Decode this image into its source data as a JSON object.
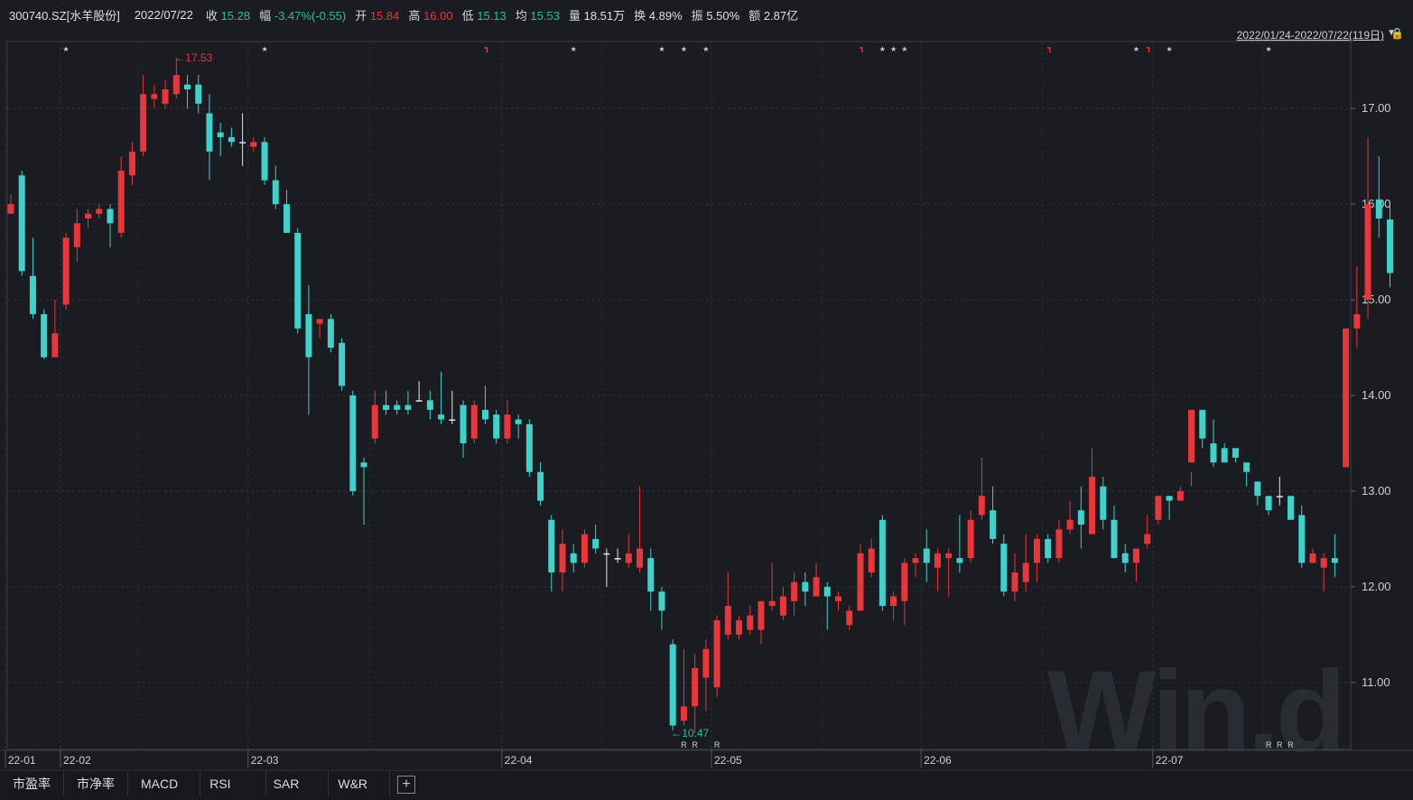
{
  "header": {
    "code": "300740.SZ[水羊股份]",
    "date": "2022/07/22",
    "close_label": "收",
    "close": "15.28",
    "change_label": "幅",
    "change": "-3.47%(-0.55)",
    "open_label": "开",
    "open": "15.84",
    "high_label": "高",
    "high": "16.00",
    "low_label": "低",
    "low": "15.13",
    "avg_label": "均",
    "avg": "15.53",
    "volume_label": "量",
    "volume": "18.51万",
    "turnover_label": "换",
    "turnover": "4.89%",
    "amplitude_label": "振",
    "amplitude": "5.50%",
    "amount_label": "额",
    "amount": "2.87亿"
  },
  "range_text": "2022/01/24-2022/07/22(119日)",
  "icons": {
    "dropdown": "triangle-down-icon",
    "lock": "lock-icon",
    "add": "plus-icon"
  },
  "colors": {
    "up": "#e8363a",
    "down": "#3fd1cc",
    "up_text": "#e8363a",
    "down_text": "#26c281",
    "grid": "#2e3138",
    "background": "#1a1c22"
  },
  "tabs": [
    "市盈率",
    "市净率",
    "MACD",
    "RSI",
    "SAR",
    "W&R"
  ],
  "watermark": "Win.d",
  "chart_data": {
    "type": "candlestick",
    "ylim": [
      10.3,
      17.7
    ],
    "yticks": [
      "17.00",
      "16.00",
      "15.00",
      "14.00",
      "13.00",
      "12.00",
      "11.00"
    ],
    "ytick_values": [
      17,
      16,
      15,
      14,
      13,
      12,
      11
    ],
    "xticks": [
      {
        "label": "22-01",
        "index": 0
      },
      {
        "label": "22-02",
        "index": 5
      },
      {
        "label": "22-03",
        "index": 22
      },
      {
        "label": "22-04",
        "index": 45
      },
      {
        "label": "22-05",
        "index": 64
      },
      {
        "label": "22-06",
        "index": 83
      },
      {
        "label": "22-07",
        "index": 104
      }
    ],
    "annotations": {
      "max": {
        "label": "17.53",
        "index": 15,
        "value": 17.53
      },
      "min": {
        "label": "10.47",
        "index": 60,
        "value": 10.47
      }
    },
    "markers": {
      "star": [
        5,
        23,
        51,
        59,
        61,
        63,
        79,
        80,
        81,
        102,
        105,
        114
      ],
      "flag": [
        43,
        77,
        94,
        103
      ],
      "R": [
        61,
        62,
        64,
        114,
        115,
        116
      ]
    },
    "candles": [
      [
        15.9,
        16.0,
        15.9,
        16.1
      ],
      [
        16.3,
        15.3,
        15.25,
        16.35
      ],
      [
        15.25,
        14.85,
        14.8,
        15.65
      ],
      [
        14.85,
        14.4,
        14.38,
        14.9
      ],
      [
        14.4,
        14.65,
        14.4,
        15.0
      ],
      [
        14.95,
        15.65,
        14.9,
        15.7
      ],
      [
        15.55,
        15.8,
        15.4,
        15.95
      ],
      [
        15.85,
        15.9,
        15.75,
        15.95
      ],
      [
        15.9,
        15.95,
        15.85,
        16.0
      ],
      [
        15.95,
        15.8,
        15.55,
        16.0
      ],
      [
        15.7,
        16.35,
        15.65,
        16.5
      ],
      [
        16.3,
        16.55,
        16.2,
        16.65
      ],
      [
        16.55,
        17.15,
        16.5,
        17.35
      ],
      [
        17.1,
        17.15,
        17.0,
        17.25
      ],
      [
        17.05,
        17.2,
        17.0,
        17.3
      ],
      [
        17.15,
        17.35,
        17.1,
        17.53
      ],
      [
        17.25,
        17.2,
        17.0,
        17.35
      ],
      [
        17.25,
        17.05,
        16.95,
        17.35
      ],
      [
        16.95,
        16.55,
        16.25,
        17.15
      ],
      [
        16.75,
        16.7,
        16.5,
        16.85
      ],
      [
        16.7,
        16.65,
        16.6,
        16.8
      ],
      [
        16.65,
        16.65,
        16.4,
        16.95
      ],
      [
        16.6,
        16.65,
        16.55,
        16.7
      ],
      [
        16.65,
        16.25,
        16.2,
        16.7
      ],
      [
        16.25,
        16.0,
        15.95,
        16.4
      ],
      [
        16.0,
        15.7,
        15.7,
        16.15
      ],
      [
        15.7,
        14.7,
        14.65,
        15.75
      ],
      [
        14.85,
        14.4,
        13.8,
        15.15
      ],
      [
        14.75,
        14.8,
        14.6,
        14.8
      ],
      [
        14.8,
        14.5,
        14.45,
        14.85
      ],
      [
        14.55,
        14.1,
        14.05,
        14.6
      ],
      [
        14.0,
        13.0,
        12.95,
        14.05
      ],
      [
        13.3,
        13.25,
        12.65,
        13.35
      ],
      [
        13.55,
        13.9,
        13.5,
        14.05
      ],
      [
        13.9,
        13.85,
        13.8,
        14.05
      ],
      [
        13.9,
        13.85,
        13.8,
        13.95
      ],
      [
        13.9,
        13.85,
        13.8,
        14.05
      ],
      [
        13.95,
        13.95,
        13.95,
        14.15
      ],
      [
        13.95,
        13.85,
        13.75,
        14.05
      ],
      [
        13.8,
        13.75,
        13.7,
        14.25
      ],
      [
        13.75,
        13.75,
        13.7,
        14.05
      ],
      [
        13.9,
        13.5,
        13.35,
        13.95
      ],
      [
        13.55,
        13.9,
        13.5,
        13.95
      ],
      [
        13.85,
        13.75,
        13.7,
        14.1
      ],
      [
        13.8,
        13.55,
        13.5,
        13.85
      ],
      [
        13.55,
        13.8,
        13.5,
        13.95
      ],
      [
        13.75,
        13.7,
        13.55,
        13.8
      ],
      [
        13.7,
        13.2,
        13.15,
        13.75
      ],
      [
        13.2,
        12.9,
        12.85,
        13.3
      ],
      [
        12.7,
        12.15,
        11.95,
        12.75
      ],
      [
        12.15,
        12.45,
        11.95,
        12.6
      ],
      [
        12.35,
        12.25,
        12.15,
        12.45
      ],
      [
        12.25,
        12.55,
        12.2,
        12.6
      ],
      [
        12.5,
        12.4,
        12.35,
        12.65
      ],
      [
        12.35,
        12.35,
        12.0,
        12.4
      ],
      [
        12.3,
        12.3,
        12.25,
        12.4
      ],
      [
        12.25,
        12.35,
        12.2,
        12.55
      ],
      [
        12.2,
        12.4,
        12.15,
        13.05
      ],
      [
        12.3,
        11.95,
        11.75,
        12.4
      ],
      [
        11.95,
        11.75,
        11.55,
        12.0
      ],
      [
        11.4,
        10.55,
        10.5,
        11.45
      ],
      [
        10.6,
        10.75,
        10.55,
        11.35
      ],
      [
        10.75,
        11.15,
        10.47,
        11.3
      ],
      [
        11.05,
        11.35,
        10.7,
        11.45
      ],
      [
        10.95,
        11.65,
        10.85,
        11.7
      ],
      [
        11.5,
        11.8,
        11.45,
        12.15
      ],
      [
        11.5,
        11.65,
        11.45,
        11.7
      ],
      [
        11.55,
        11.7,
        11.5,
        11.8
      ],
      [
        11.55,
        11.85,
        11.4,
        11.85
      ],
      [
        11.8,
        11.85,
        11.75,
        12.25
      ],
      [
        11.7,
        11.9,
        11.65,
        12.0
      ],
      [
        11.85,
        12.05,
        11.7,
        12.15
      ],
      [
        12.05,
        11.95,
        11.8,
        12.15
      ],
      [
        11.9,
        12.1,
        11.9,
        12.25
      ],
      [
        12.0,
        11.9,
        11.55,
        12.05
      ],
      [
        11.85,
        11.9,
        11.75,
        11.95
      ],
      [
        11.6,
        11.75,
        11.55,
        11.8
      ],
      [
        11.75,
        12.35,
        11.75,
        12.45
      ],
      [
        12.15,
        12.4,
        12.1,
        12.5
      ],
      [
        12.7,
        11.8,
        11.75,
        12.75
      ],
      [
        11.8,
        11.9,
        11.65,
        11.95
      ],
      [
        11.85,
        12.25,
        11.6,
        12.3
      ],
      [
        12.25,
        12.3,
        12.1,
        12.35
      ],
      [
        12.4,
        12.25,
        12.05,
        12.6
      ],
      [
        12.2,
        12.35,
        11.95,
        12.4
      ],
      [
        12.3,
        12.35,
        11.9,
        12.4
      ],
      [
        12.3,
        12.25,
        12.15,
        12.75
      ],
      [
        12.3,
        12.7,
        12.25,
        12.8
      ],
      [
        12.75,
        12.95,
        12.7,
        13.35
      ],
      [
        12.8,
        12.5,
        12.45,
        13.05
      ],
      [
        12.45,
        11.95,
        11.9,
        12.55
      ],
      [
        11.95,
        12.15,
        11.85,
        12.35
      ],
      [
        12.05,
        12.25,
        11.95,
        12.55
      ],
      [
        12.25,
        12.5,
        12.05,
        12.55
      ],
      [
        12.5,
        12.3,
        12.25,
        12.55
      ],
      [
        12.3,
        12.6,
        12.25,
        12.7
      ],
      [
        12.6,
        12.7,
        12.55,
        12.9
      ],
      [
        12.8,
        12.65,
        12.4,
        13.05
      ],
      [
        12.55,
        13.15,
        12.55,
        13.45
      ],
      [
        13.05,
        12.7,
        12.6,
        13.15
      ],
      [
        12.7,
        12.3,
        12.3,
        12.85
      ],
      [
        12.35,
        12.25,
        12.15,
        12.45
      ],
      [
        12.25,
        12.4,
        12.05,
        12.4
      ],
      [
        12.45,
        12.55,
        12.4,
        12.75
      ],
      [
        12.7,
        12.95,
        12.65,
        12.95
      ],
      [
        12.95,
        12.9,
        12.7,
        12.95
      ],
      [
        12.9,
        13.0,
        12.9,
        13.05
      ],
      [
        13.3,
        13.85,
        13.05,
        13.2
      ],
      [
        13.85,
        13.55,
        13.45,
        13.85
      ],
      [
        13.5,
        13.3,
        13.25,
        13.75
      ],
      [
        13.45,
        13.3,
        13.3,
        13.5
      ],
      [
        13.45,
        13.35,
        13.3,
        13.35
      ],
      [
        13.3,
        13.2,
        13.05,
        13.2
      ],
      [
        13.1,
        12.95,
        12.85,
        13.1
      ],
      [
        12.95,
        12.8,
        12.75,
        12.95
      ],
      [
        12.95,
        12.95,
        12.85,
        13.15
      ],
      [
        12.95,
        12.7,
        12.7,
        12.95
      ],
      [
        12.75,
        12.25,
        12.2,
        12.85
      ],
      [
        12.25,
        12.35,
        12.25,
        12.4
      ],
      [
        12.2,
        12.3,
        11.95,
        12.35
      ],
      [
        12.3,
        12.25,
        12.1,
        12.55
      ],
      [
        13.25,
        14.7,
        13.25,
        14.7
      ],
      [
        14.7,
        14.85,
        14.5,
        15.35
      ],
      [
        15.0,
        16.0,
        14.8,
        16.7
      ],
      [
        16.05,
        15.85,
        15.65,
        16.5
      ],
      [
        15.84,
        15.28,
        15.13,
        16.0
      ]
    ]
  }
}
